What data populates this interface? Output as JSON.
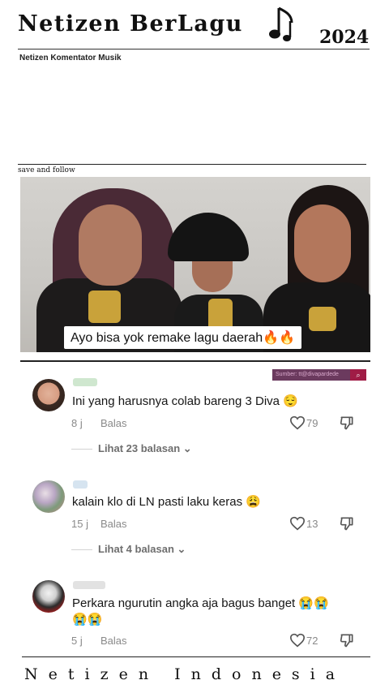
{
  "header": {
    "brand": "Netizen BerLagu",
    "year": "2024",
    "subtitle": "Netizen Komentator Musik",
    "music_icon": "music-note-icon"
  },
  "save_follow": "save and follow",
  "video": {
    "caption": "Ayo bisa yok remake lagu daerah🔥🔥",
    "source_label": "Sumber: tt@divapardede",
    "source_icon": "search-icon"
  },
  "comments": [
    {
      "text": "Ini yang harusnya colab bareng 3 Diva 😌",
      "time": "8 j",
      "reply_label": "Balas",
      "likes": "79",
      "replies_label": "Lihat 23 balasan"
    },
    {
      "text": "kalain klo di LN pasti laku keras 😩",
      "time": "15 j",
      "reply_label": "Balas",
      "likes": "13",
      "replies_label": "Lihat 4 balasan"
    },
    {
      "text": "Perkara ngurutin angka aja bagus banget 😭😭",
      "text_line2": "😭😭",
      "time": "5 j",
      "reply_label": "Balas",
      "likes": "72"
    }
  ],
  "footer": "Netizen Indonesia",
  "colors": {
    "source_bg": "#6b3a5e",
    "source_search_bg": "#a01c46",
    "meta_gray": "#8a8a8a"
  }
}
